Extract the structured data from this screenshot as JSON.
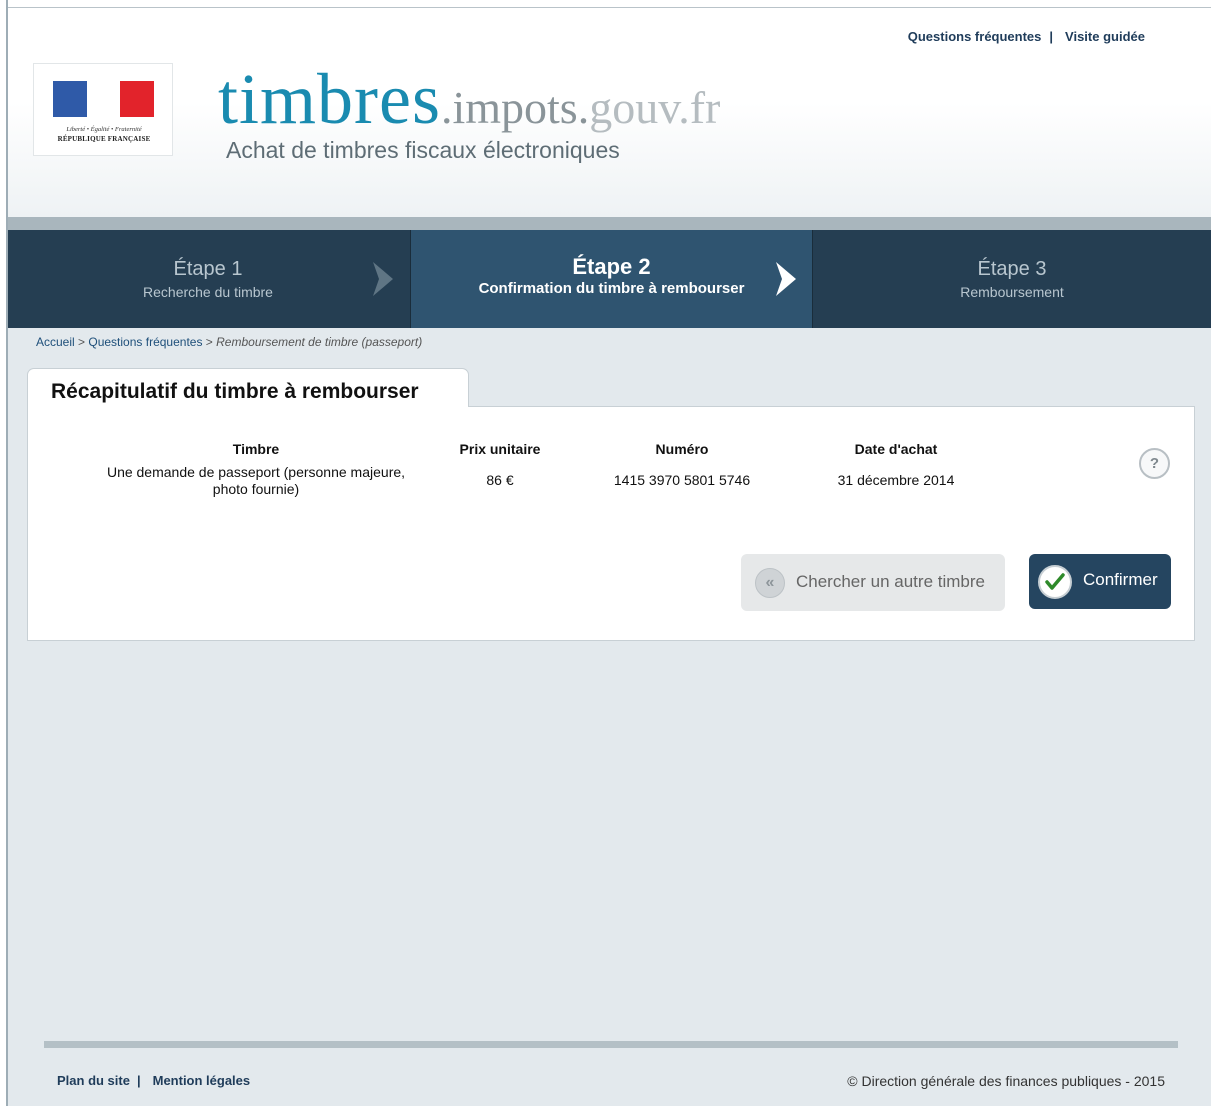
{
  "header": {
    "top_links": [
      "Questions fréquentes",
      "Visite guidée"
    ],
    "logo_motto": "Liberté • Égalité • Fraternité",
    "logo_republic": "RÉPUBLIQUE FRANÇAISE",
    "brand_main": "timbres",
    "brand_mid": ".impots.",
    "brand_end": "gouv.fr",
    "tagline": "Achat de timbres fiscaux électroniques"
  },
  "steps": [
    {
      "title": "Étape 1",
      "subtitle": "Recherche du timbre",
      "active": false
    },
    {
      "title": "Étape 2",
      "subtitle": "Confirmation du timbre à rembourser",
      "active": true
    },
    {
      "title": "Étape 3",
      "subtitle": "Remboursement",
      "active": false
    }
  ],
  "breadcrumb": {
    "home": "Accueil",
    "faq": "Questions fréquentes",
    "current": "Remboursement de timbre (passeport)"
  },
  "summary": {
    "tab_title": "Récapitulatif du timbre à rembourser",
    "columns": {
      "stamp": "Timbre",
      "price": "Prix unitaire",
      "number": "Numéro",
      "date": "Date d'achat"
    },
    "row": {
      "stamp": "Une demande de passeport (personne majeure, photo fournie)",
      "price": "86 €",
      "number": "1415 3970 5801 5746",
      "date": "31 décembre 2014"
    },
    "help_glyph": "?",
    "search_button": "Chercher un autre timbre",
    "search_icon_glyph": "«",
    "confirm_button": "Confirmer"
  },
  "footer": {
    "links": [
      "Plan du site",
      "Mention légales"
    ],
    "copyright": "© Direction générale des finances publiques - 2015"
  },
  "colors": {
    "brand_blue": "#1a8bb0",
    "step_dark": "#253e52",
    "step_active": "#2f5470",
    "confirm_button": "#254560",
    "check_green": "#2e8a2a"
  }
}
